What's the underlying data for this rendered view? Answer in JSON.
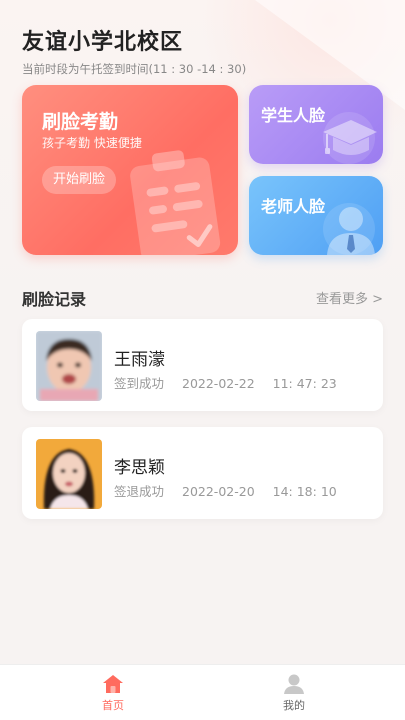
{
  "header": {
    "school_name": "友谊小学北校区",
    "time_hint": "当前时段为午托签到时间(11 : 30 -14 : 30)"
  },
  "cards": {
    "attendance": {
      "title": "刷脸考勤",
      "subtitle": "孩子考勤  快速便捷",
      "button": "开始刷脸"
    },
    "student_face": {
      "title": "学生人脸"
    },
    "teacher_face": {
      "title": "老师人脸"
    }
  },
  "records_section": {
    "title": "刷脸记录",
    "more": "查看更多 >"
  },
  "records": [
    {
      "name": "王雨濛",
      "status": "签到成功",
      "date": "2022-02-22",
      "time": "11: 47: 23"
    },
    {
      "name": "李思颖",
      "status": "签退成功",
      "date": "2022-02-20",
      "time": "14: 18: 10"
    }
  ],
  "nav": {
    "home_label": "首页",
    "mine_label": "我的"
  },
  "colors": {
    "accent": "#ff6b5e",
    "attendance_card": "#ff7a6c",
    "student_card": "#a98af4",
    "teacher_card": "#5aa9f6"
  },
  "icons": {
    "attendance_card": "clipboard-icon",
    "student_card": "graduation-cap-icon",
    "teacher_card": "teacher-icon",
    "nav_home": "home-icon",
    "nav_mine": "user-icon"
  }
}
